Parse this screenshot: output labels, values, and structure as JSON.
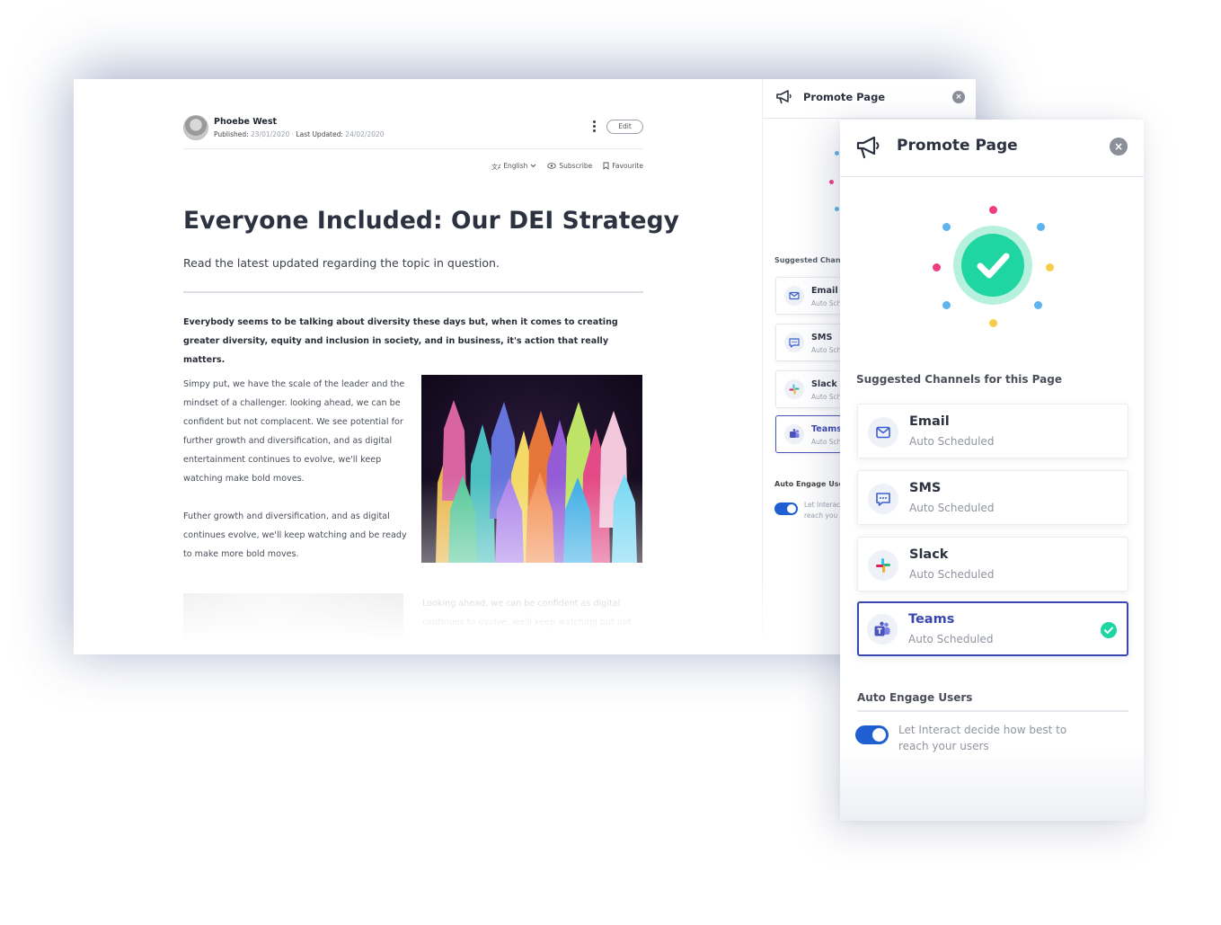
{
  "article": {
    "author": {
      "name": "Phoebe West",
      "published_label": "Published:",
      "published_date": "23/01/2020",
      "separator": "·",
      "updated_label": "Last Updated:",
      "updated_date": "24/02/2020"
    },
    "edit_label": "Edit",
    "actions": {
      "language": "English",
      "subscribe": "Subscribe",
      "favourite": "Favourite"
    },
    "title": "Everyone Included: Our DEI Strategy",
    "subtitle": "Read the latest updated regarding the topic in question.",
    "lead": "Everybody seems to be talking about diversity these days but, when it comes to creating greater diversity, equity and inclusion in society, and in business, it's action that really matters.",
    "paragraph1": "Simpy put, we have the scale of the leader and the mindset of a challenger. looking ahead, we can be confident but not complacent. We see potential for further growth and diversification, and as digital entertainment continues to evolve, we'll keep watching make bold moves.",
    "paragraph2": "Futher growth and diversification, and as digital continues evolve, we'll keep watching and be ready to make more bold moves.",
    "paragraph3": "Looking ahead, we can be confident as digital continues to evolve, we'll keep watching but not"
  },
  "back_panel": {
    "title": "Promote Page",
    "suggested_label": "Suggested Chann",
    "channels": [
      {
        "name": "Email",
        "status": "Auto Sch"
      },
      {
        "name": "SMS",
        "status": "Auto Sch"
      },
      {
        "name": "Slack",
        "status": "Auto Sch"
      },
      {
        "name": "Teams",
        "status": "Auto Sch"
      }
    ],
    "engage_label": "Auto Engage User",
    "toggle_text": "Let Interac reach you"
  },
  "promote_panel": {
    "title": "Promote Page",
    "suggested_label": "Suggested Channels for this Page",
    "channels": [
      {
        "name": "Email",
        "status": "Auto Scheduled",
        "selected": false
      },
      {
        "name": "SMS",
        "status": "Auto Scheduled",
        "selected": false
      },
      {
        "name": "Slack",
        "status": "Auto Scheduled",
        "selected": false
      },
      {
        "name": "Teams",
        "status": "Auto Scheduled",
        "selected": true
      }
    ],
    "engage_label": "Auto Engage Users",
    "toggle_on": true,
    "toggle_text": "Let Interact decide how best to reach your users"
  },
  "colors": {
    "accent_blue": "#1f5fd1",
    "teams_indigo": "#3a46b0",
    "success_green": "#1fd6a2",
    "dot_pink": "#ee3d83",
    "dot_blue": "#5db4ee",
    "dot_yellow": "#f5cd4a"
  },
  "icons": {
    "header": "megaphone-icon",
    "close": "close-icon",
    "email": "envelope-icon",
    "sms": "chat-bubble-icon",
    "slack": "slack-icon",
    "teams": "teams-icon",
    "success": "checkmark-icon"
  }
}
